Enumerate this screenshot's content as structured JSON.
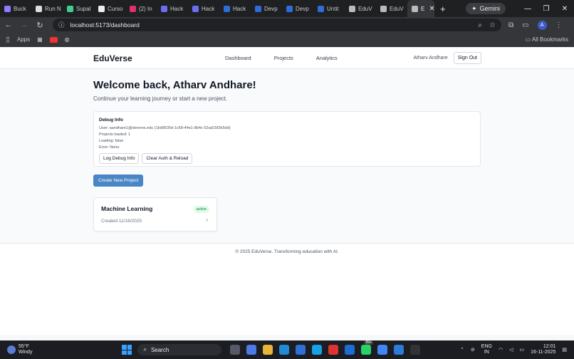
{
  "browser": {
    "tabs": [
      {
        "label": "Buck",
        "color": "#8e7cff"
      },
      {
        "label": "Run N",
        "color": "#dddddd"
      },
      {
        "label": "Supal",
        "color": "#3ecf8e"
      },
      {
        "label": "Curso",
        "color": "#eeeeee"
      },
      {
        "label": "(2) In",
        "color": "#e1306c"
      },
      {
        "label": "Hack",
        "color": "#6a6ff0"
      },
      {
        "label": "Hack",
        "color": "#6a6ff0"
      },
      {
        "label": "Hack",
        "color": "#2f6bd9"
      },
      {
        "label": "Devp",
        "color": "#2f6bd9"
      },
      {
        "label": "Devp",
        "color": "#2f6bd9"
      },
      {
        "label": "Untit",
        "color": "#2f6bd9"
      },
      {
        "label": "EduV",
        "color": "#bbbbbb"
      },
      {
        "label": "EduV",
        "color": "#bbbbbb"
      }
    ],
    "active_tab": {
      "label": "E"
    },
    "gemini_label": "Gemini",
    "url": "localhost:5173/dashboard",
    "bookmarks": {
      "apps_label": "Apps",
      "all_label": "All Bookmarks"
    },
    "profile_initial": "A"
  },
  "app": {
    "brand": "EduVerse",
    "nav": {
      "dashboard": "Dashboard",
      "projects": "Projects",
      "analytics": "Analytics"
    },
    "user_name": "Atharv Andhare",
    "signout_label": "Sign Out"
  },
  "main": {
    "welcome": "Welcome back, Atharv Andhare!",
    "subtitle": "Continue your learning journey or start a new project.",
    "debug": {
      "title": "Debug Info",
      "user": "User: aandhare1@stevens.edu (1bd9530d-1c68-44e1-8b4c-52ad15f2b5dd)",
      "projects": "Projects loaded: 1",
      "loading": "Loading: false",
      "error": "Error: None",
      "log_button": "Log Debug Info",
      "clear_button": "Clear Auth & Reload"
    },
    "create_button": "Create New Project",
    "project": {
      "title": "Machine Learning",
      "status": "active",
      "created": "Created 11/16/2025"
    }
  },
  "footer": {
    "text": "© 2025 EduVerse. Transforming education with AI."
  },
  "taskbar": {
    "weather_temp": "55°F",
    "weather_desc": "Windy",
    "search_label": "Search",
    "badge_count": "99+",
    "lang_line1": "ENG",
    "lang_line2": "IN",
    "time": "12:01",
    "date": "16-11-2025"
  }
}
